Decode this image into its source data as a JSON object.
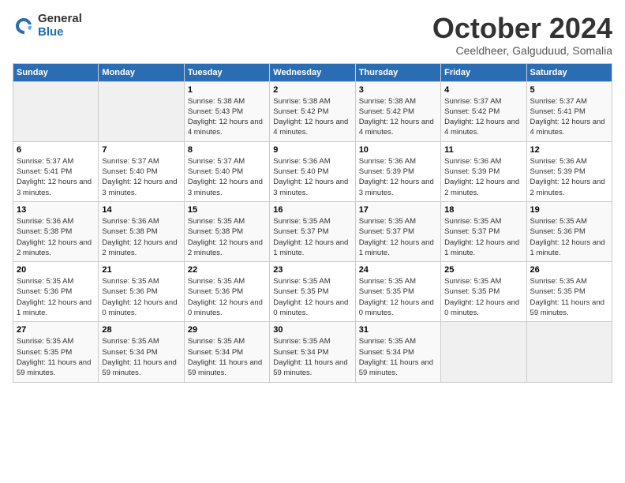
{
  "logo": {
    "general": "General",
    "blue": "Blue"
  },
  "header": {
    "title": "October 2024",
    "subtitle": "Ceeldheer, Galguduud, Somalia"
  },
  "weekdays": [
    "Sunday",
    "Monday",
    "Tuesday",
    "Wednesday",
    "Thursday",
    "Friday",
    "Saturday"
  ],
  "weeks": [
    [
      {
        "day": "",
        "info": ""
      },
      {
        "day": "",
        "info": ""
      },
      {
        "day": "1",
        "info": "Sunrise: 5:38 AM\nSunset: 5:43 PM\nDaylight: 12 hours and 4 minutes."
      },
      {
        "day": "2",
        "info": "Sunrise: 5:38 AM\nSunset: 5:42 PM\nDaylight: 12 hours and 4 minutes."
      },
      {
        "day": "3",
        "info": "Sunrise: 5:38 AM\nSunset: 5:42 PM\nDaylight: 12 hours and 4 minutes."
      },
      {
        "day": "4",
        "info": "Sunrise: 5:37 AM\nSunset: 5:42 PM\nDaylight: 12 hours and 4 minutes."
      },
      {
        "day": "5",
        "info": "Sunrise: 5:37 AM\nSunset: 5:41 PM\nDaylight: 12 hours and 4 minutes."
      }
    ],
    [
      {
        "day": "6",
        "info": "Sunrise: 5:37 AM\nSunset: 5:41 PM\nDaylight: 12 hours and 3 minutes."
      },
      {
        "day": "7",
        "info": "Sunrise: 5:37 AM\nSunset: 5:40 PM\nDaylight: 12 hours and 3 minutes."
      },
      {
        "day": "8",
        "info": "Sunrise: 5:37 AM\nSunset: 5:40 PM\nDaylight: 12 hours and 3 minutes."
      },
      {
        "day": "9",
        "info": "Sunrise: 5:36 AM\nSunset: 5:40 PM\nDaylight: 12 hours and 3 minutes."
      },
      {
        "day": "10",
        "info": "Sunrise: 5:36 AM\nSunset: 5:39 PM\nDaylight: 12 hours and 3 minutes."
      },
      {
        "day": "11",
        "info": "Sunrise: 5:36 AM\nSunset: 5:39 PM\nDaylight: 12 hours and 2 minutes."
      },
      {
        "day": "12",
        "info": "Sunrise: 5:36 AM\nSunset: 5:39 PM\nDaylight: 12 hours and 2 minutes."
      }
    ],
    [
      {
        "day": "13",
        "info": "Sunrise: 5:36 AM\nSunset: 5:38 PM\nDaylight: 12 hours and 2 minutes."
      },
      {
        "day": "14",
        "info": "Sunrise: 5:36 AM\nSunset: 5:38 PM\nDaylight: 12 hours and 2 minutes."
      },
      {
        "day": "15",
        "info": "Sunrise: 5:35 AM\nSunset: 5:38 PM\nDaylight: 12 hours and 2 minutes."
      },
      {
        "day": "16",
        "info": "Sunrise: 5:35 AM\nSunset: 5:37 PM\nDaylight: 12 hours and 1 minute."
      },
      {
        "day": "17",
        "info": "Sunrise: 5:35 AM\nSunset: 5:37 PM\nDaylight: 12 hours and 1 minute."
      },
      {
        "day": "18",
        "info": "Sunrise: 5:35 AM\nSunset: 5:37 PM\nDaylight: 12 hours and 1 minute."
      },
      {
        "day": "19",
        "info": "Sunrise: 5:35 AM\nSunset: 5:36 PM\nDaylight: 12 hours and 1 minute."
      }
    ],
    [
      {
        "day": "20",
        "info": "Sunrise: 5:35 AM\nSunset: 5:36 PM\nDaylight: 12 hours and 1 minute."
      },
      {
        "day": "21",
        "info": "Sunrise: 5:35 AM\nSunset: 5:36 PM\nDaylight: 12 hours and 0 minutes."
      },
      {
        "day": "22",
        "info": "Sunrise: 5:35 AM\nSunset: 5:36 PM\nDaylight: 12 hours and 0 minutes."
      },
      {
        "day": "23",
        "info": "Sunrise: 5:35 AM\nSunset: 5:35 PM\nDaylight: 12 hours and 0 minutes."
      },
      {
        "day": "24",
        "info": "Sunrise: 5:35 AM\nSunset: 5:35 PM\nDaylight: 12 hours and 0 minutes."
      },
      {
        "day": "25",
        "info": "Sunrise: 5:35 AM\nSunset: 5:35 PM\nDaylight: 12 hours and 0 minutes."
      },
      {
        "day": "26",
        "info": "Sunrise: 5:35 AM\nSunset: 5:35 PM\nDaylight: 11 hours and 59 minutes."
      }
    ],
    [
      {
        "day": "27",
        "info": "Sunrise: 5:35 AM\nSunset: 5:35 PM\nDaylight: 11 hours and 59 minutes."
      },
      {
        "day": "28",
        "info": "Sunrise: 5:35 AM\nSunset: 5:34 PM\nDaylight: 11 hours and 59 minutes."
      },
      {
        "day": "29",
        "info": "Sunrise: 5:35 AM\nSunset: 5:34 PM\nDaylight: 11 hours and 59 minutes."
      },
      {
        "day": "30",
        "info": "Sunrise: 5:35 AM\nSunset: 5:34 PM\nDaylight: 11 hours and 59 minutes."
      },
      {
        "day": "31",
        "info": "Sunrise: 5:35 AM\nSunset: 5:34 PM\nDaylight: 11 hours and 59 minutes."
      },
      {
        "day": "",
        "info": ""
      },
      {
        "day": "",
        "info": ""
      }
    ]
  ]
}
